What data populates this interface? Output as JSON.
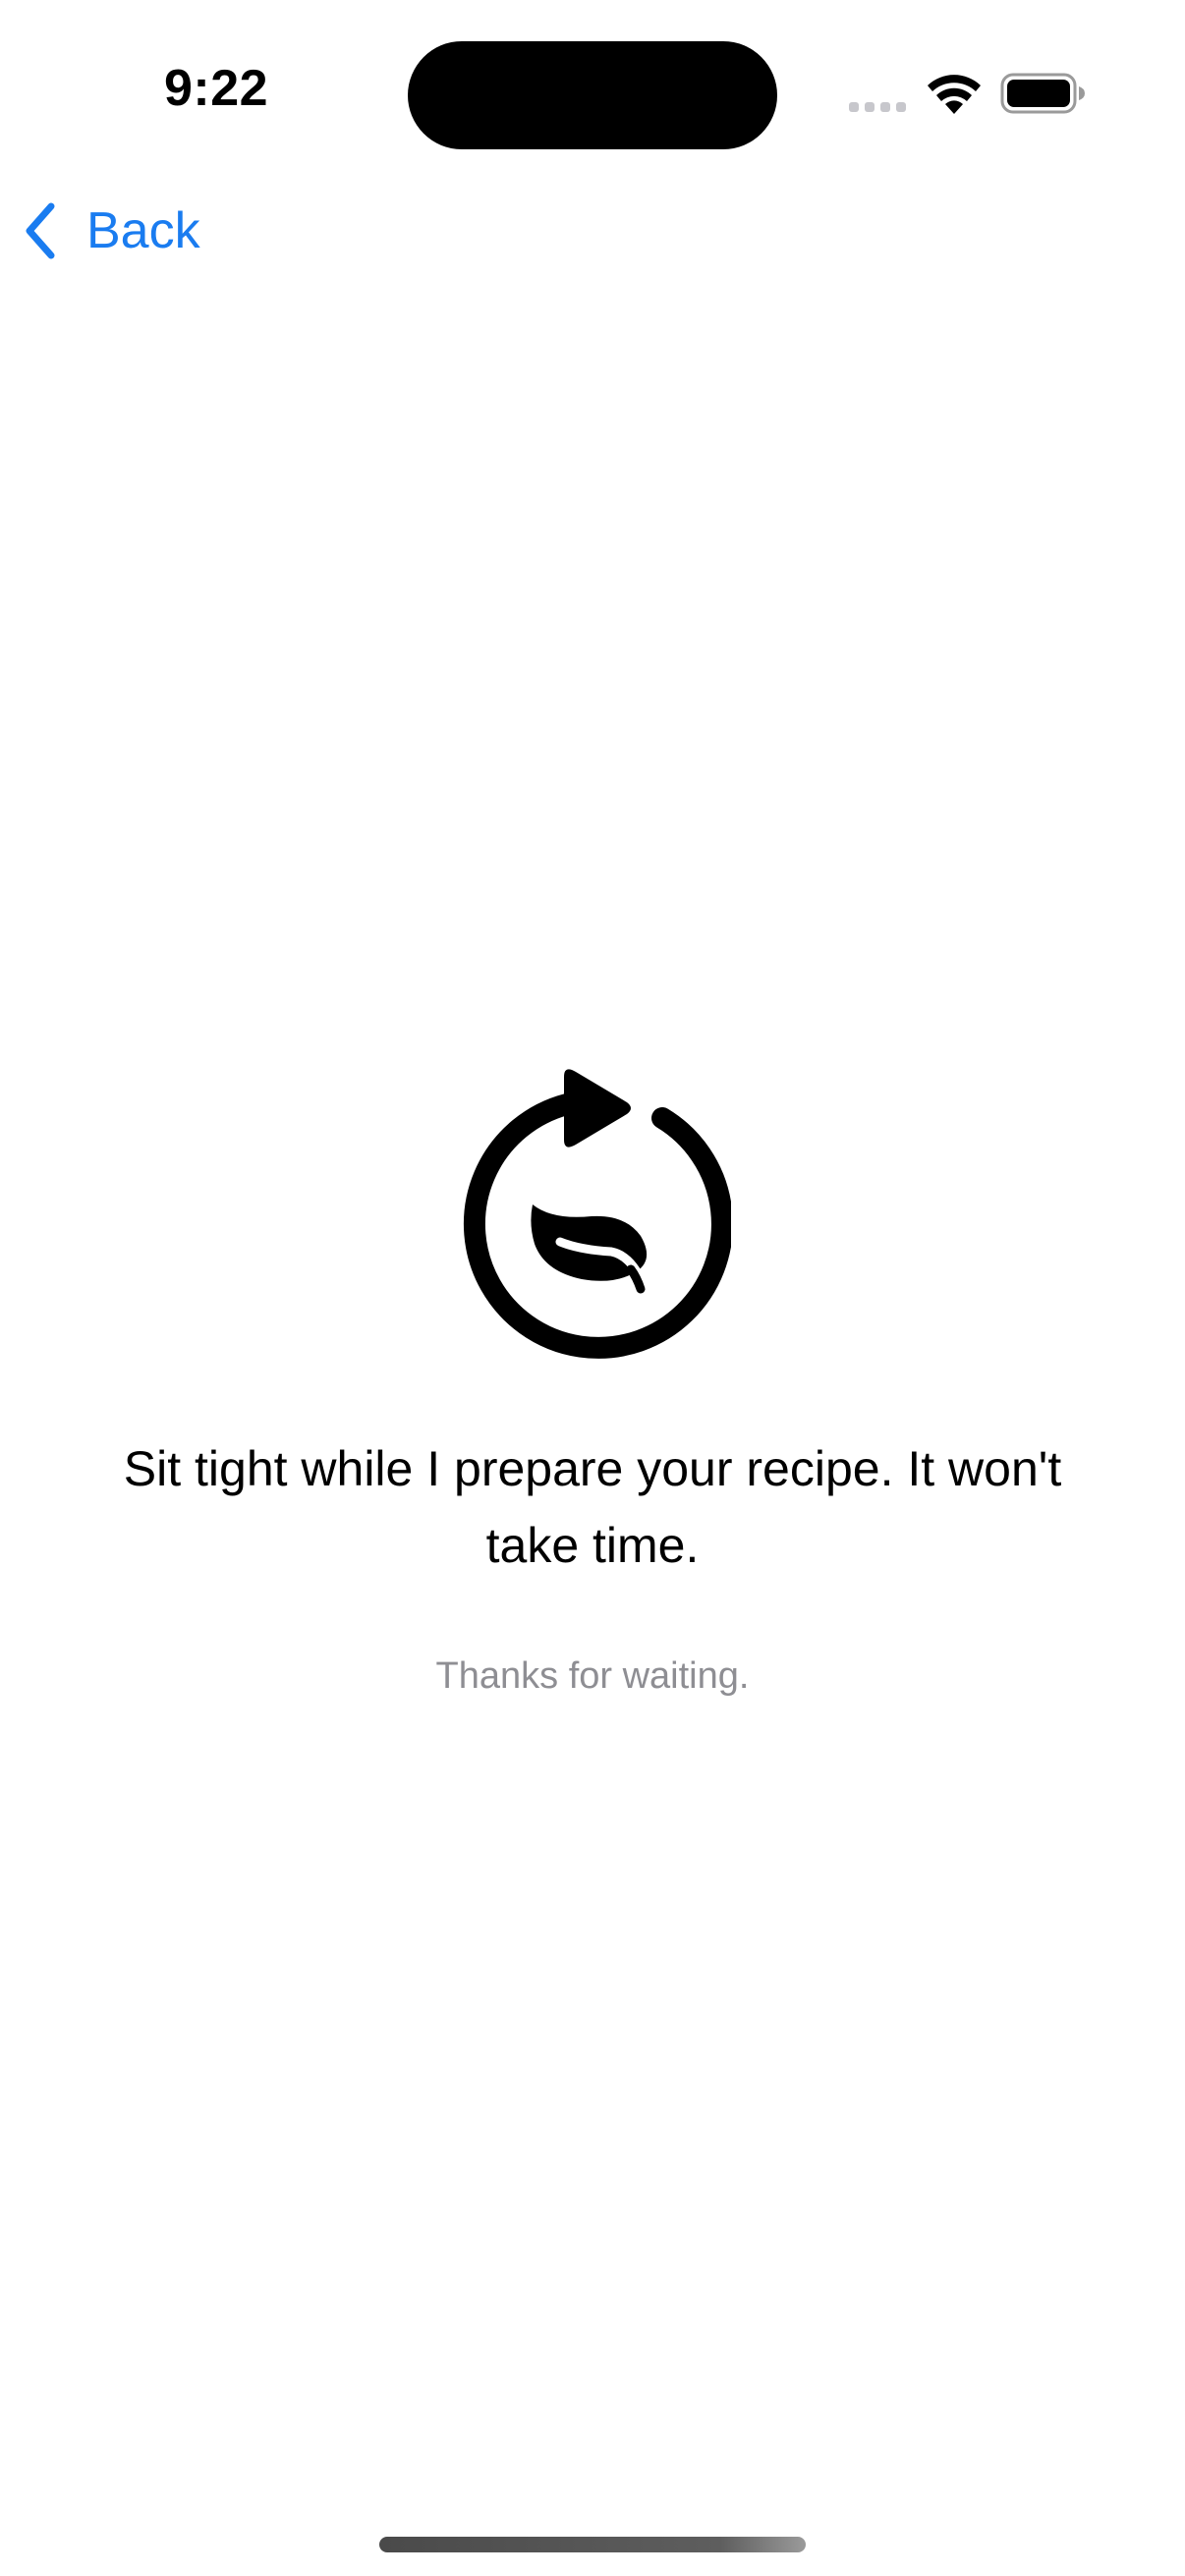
{
  "status_bar": {
    "time": "9:22",
    "icons": [
      "signal-dots-icon",
      "wifi-icon",
      "battery-icon"
    ]
  },
  "nav": {
    "back_label": "Back",
    "back_icon": "chevron-left-icon",
    "accent_color": "#1a7cf0"
  },
  "loading": {
    "icon": "refresh-leaf-icon",
    "message": "Sit tight while I prepare your recipe. It won't take time.",
    "sub_message": "Thanks for waiting."
  },
  "colors": {
    "background": "#ffffff",
    "text_primary": "#000000",
    "text_secondary": "#8e8e93"
  }
}
